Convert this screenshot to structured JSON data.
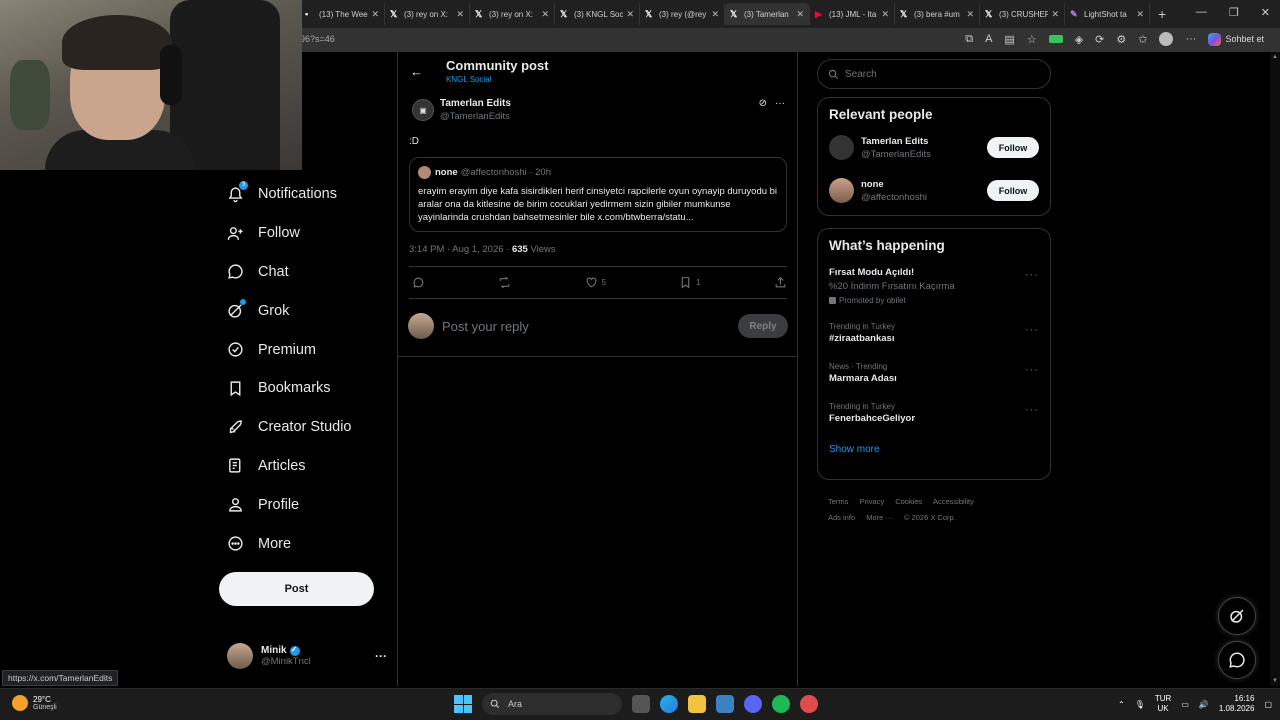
{
  "browser": {
    "tabs": [
      {
        "icon": "webpage",
        "title": "(13) The Wee"
      },
      {
        "icon": "x",
        "title": "(3) rey on X:"
      },
      {
        "icon": "x",
        "title": "(3) rey on X:"
      },
      {
        "icon": "x",
        "title": "(3) KNGL Soci"
      },
      {
        "icon": "x",
        "title": "(3) rey (@rey"
      },
      {
        "icon": "x",
        "title": "(3) Tamerlan"
      },
      {
        "icon": "youtube",
        "title": "(13) JML - Ita"
      },
      {
        "icon": "x",
        "title": "(3) bera #um"
      },
      {
        "icon": "x",
        "title": "(3) CRUSHER"
      },
      {
        "icon": "lightshot",
        "title": "LightShot ta"
      }
    ],
    "url": "96?s=46",
    "copilot_label": "Sohbet et"
  },
  "nav": {
    "items": [
      {
        "name": "notifications",
        "label": "Notifications",
        "badge": "3"
      },
      {
        "name": "follow",
        "label": "Follow"
      },
      {
        "name": "chat",
        "label": "Chat"
      },
      {
        "name": "grok",
        "label": "Grok"
      },
      {
        "name": "premium",
        "label": "Premium"
      },
      {
        "name": "bookmarks",
        "label": "Bookmarks"
      },
      {
        "name": "creator-studio",
        "label": "Creator Studio"
      },
      {
        "name": "articles",
        "label": "Articles"
      },
      {
        "name": "profile",
        "label": "Profile"
      },
      {
        "name": "more",
        "label": "More"
      }
    ],
    "post_label": "Post",
    "account": {
      "name": "Minik",
      "handle": "@MinikTncl"
    }
  },
  "header": {
    "title": "Community post",
    "subtitle": "KNGL Social"
  },
  "post": {
    "author_name": "Tamerlan Edits",
    "author_handle": "@TamerlanEdits",
    "text": ":D",
    "quote": {
      "name": "none",
      "meta": "@affectonhoshi · 20h",
      "body": "erayim erayim diye kafa sisirdikleri herif cinsiyetci rapcilerle oyun oynayip duruyodu bi aralar ona da kitlesine de birim cocuklari yedirmem sizin gibiler mumkunse yayinlarinda crushdan bahsetmesinler bile x.com/btwberra/statu..."
    },
    "timestamp": "3:14 PM · Aug 1, 2026 · ",
    "views_count": "635",
    "views_label": " Views",
    "likes": "5",
    "bookmarks": "1",
    "reply_placeholder": "Post your reply",
    "reply_button": "Reply"
  },
  "search": {
    "placeholder": "Search"
  },
  "relevant_people": {
    "title": "Relevant people",
    "people": [
      {
        "name": "Tamerlan Edits",
        "handle": "@TamerlanEdits",
        "action": "Follow"
      },
      {
        "name": "none",
        "handle": "@affectonhoshi",
        "action": "Follow"
      }
    ]
  },
  "whats_happening": {
    "title": "What’s happening",
    "promo": {
      "title": "Fırsat Modu Açıldı!",
      "desc": "%20 İndirim Fırsatını Kaçırma",
      "promoted": "Promoted by obilet"
    },
    "trends": [
      {
        "meta": "Trending in Turkey",
        "title": "#ziraatbankası"
      },
      {
        "meta": "News · Trending",
        "title": "Marmara Adası"
      },
      {
        "meta": "Trending in Turkey",
        "title": "FenerbahceGeliyor"
      }
    ],
    "show_more": "Show more"
  },
  "footer": {
    "links": [
      "Terms",
      "Privacy",
      "Cookies",
      "Accessibility",
      "Ads info",
      "More ···",
      "© 2026 X Corp."
    ]
  },
  "status_url": "https://x.com/TamerlanEdits",
  "taskbar": {
    "temp": "29°C",
    "condition": "Güneşli",
    "search": "Ara",
    "lang_top": "TUR",
    "lang_bottom": "UK",
    "time": "16:16",
    "date": "1.08.2026"
  }
}
